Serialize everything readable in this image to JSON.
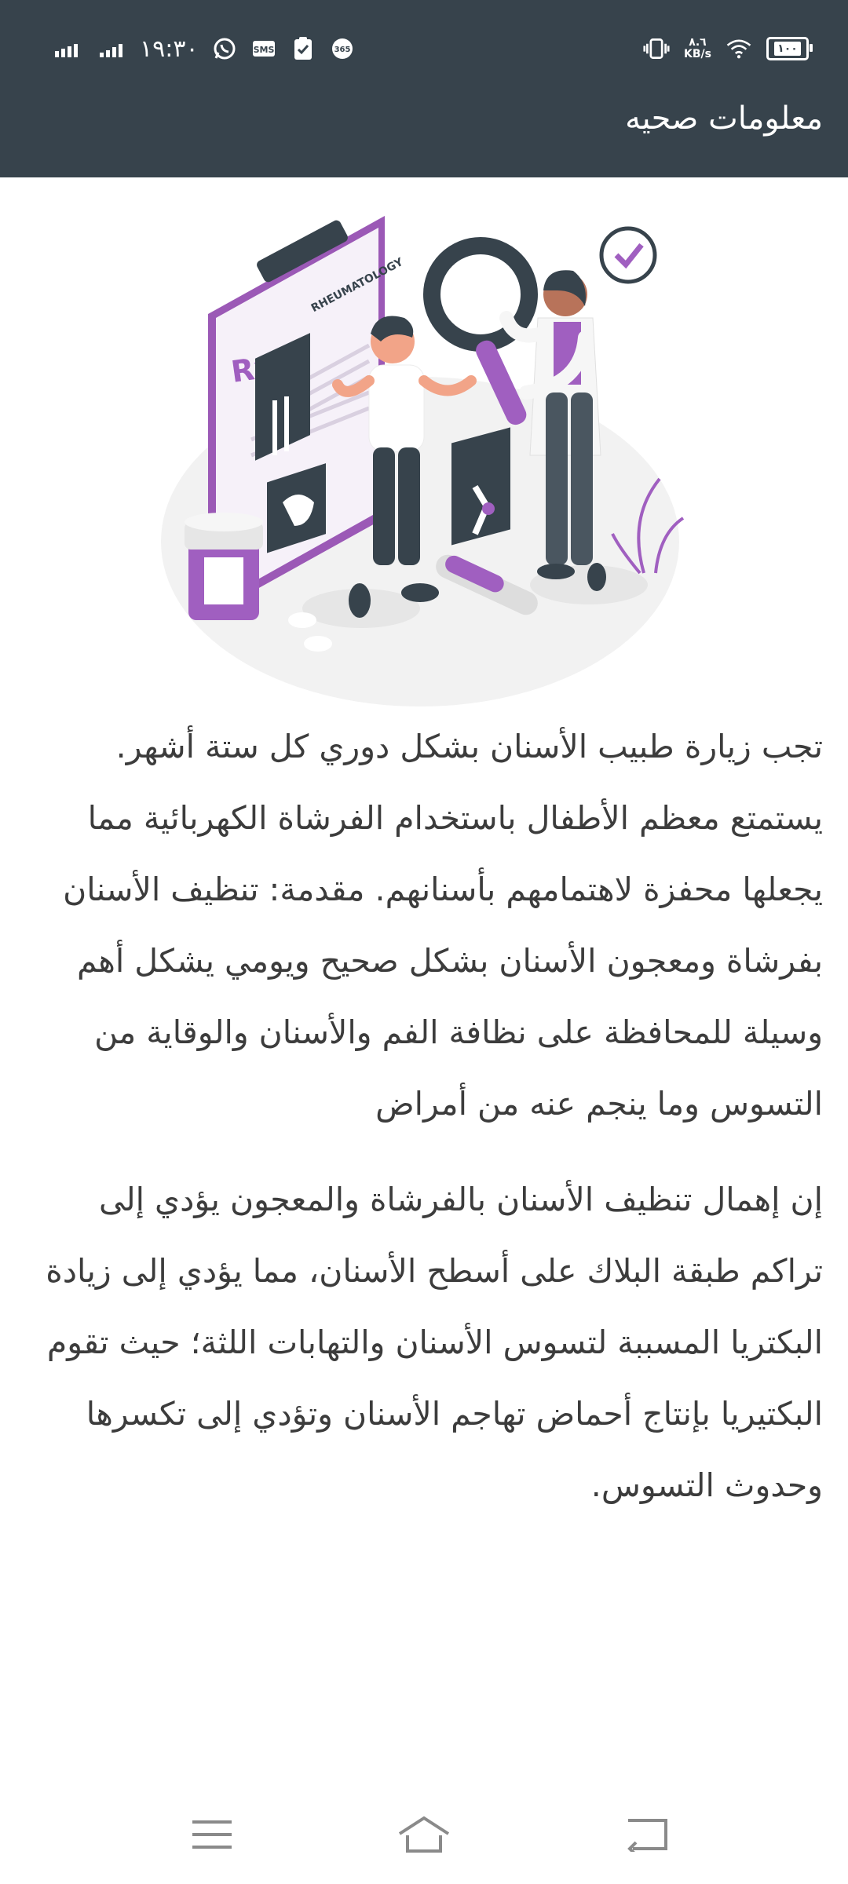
{
  "status_bar": {
    "time": "١٩:٣٠",
    "network_speed_value": "٨.٦",
    "network_speed_unit": "KB/s",
    "battery": "١٠٠",
    "icons": [
      "signal-icon",
      "signal-icon",
      "whatsapp-icon",
      "sms-icon",
      "clipboard-icon",
      "app-365-icon",
      "vibrate-icon",
      "wifi-icon",
      "battery-icon"
    ]
  },
  "header": {
    "title": "معلومات صحيه"
  },
  "illustration": {
    "clipboard_label": "RHEUMATOLOGY",
    "rx_label": "Rx",
    "accent_color": "#a05fc0"
  },
  "article": {
    "paragraphs": [
      "تجب زيارة طبيب الأسنان بشكل دوري كل ستة أشهر. يستمتع معظم الأطفال باستخدام الفرشاة الكهربائية مما يجعلها محفزة لاهتمامهم بأسنانهم. مقدمة: تنظيف الأسنان بفرشاة ومعجون الأسنان بشكل صحيح ويومي يشكل أهم وسيلة للمحافظة على نظافة الفم والأسنان والوقاية من التسوس وما ينجم عنه من أمراض",
      "إن إهمال تنظيف الأسنان بالفرشاة والمعجون يؤدي إلى تراكم طبقة البلاك على أسطح الأسنان، مما يؤدي إلى زيادة البكتريا المسببة لتسوس الأسنان والتهابات اللثة؛ حيث تقوم البكتيريا بإنتاج أحماض تهاجم الأسنان وتؤدي إلى تكسرها وحدوث التسوس."
    ]
  },
  "navigation": {
    "buttons": [
      "menu-icon",
      "home-icon",
      "back-icon"
    ]
  },
  "colors": {
    "header_bg": "#37434c",
    "text": "#3c3c3c",
    "accent": "#a05fc0"
  }
}
